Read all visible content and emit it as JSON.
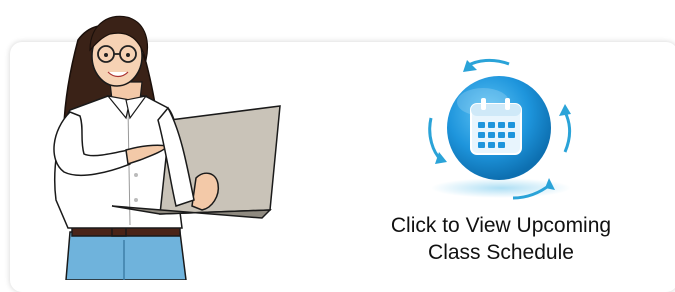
{
  "card": {
    "cta_line1": "Click to View Upcoming",
    "cta_line2": "Class Schedule"
  },
  "icons": {
    "main": "calendar-icon",
    "decor": "refresh-arrows-icon"
  },
  "colors": {
    "accent_blue": "#1e95dc",
    "arrow_teal": "#2aa3d8",
    "text": "#111111"
  }
}
